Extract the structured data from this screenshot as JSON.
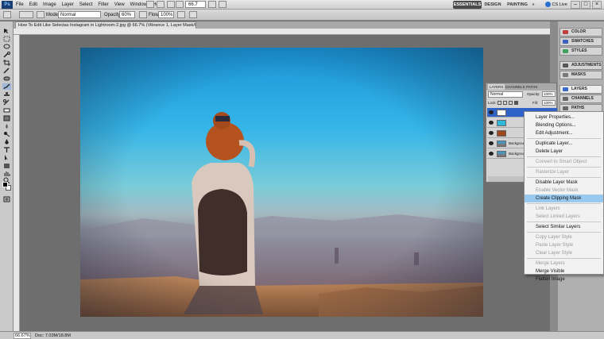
{
  "menubar": {
    "logo": "Ps",
    "items": [
      "File",
      "Edit",
      "Image",
      "Layer",
      "Select",
      "Filter",
      "View",
      "Window",
      "Help"
    ],
    "zoom": "66.7",
    "workspaces": [
      "ESSENTIALS",
      "DESIGN",
      "PAINTING",
      "»"
    ],
    "cs_live": "CS Live"
  },
  "options": {
    "mode_label": "Mode:",
    "mode_value": "Normal",
    "opacity_label": "Opacity:",
    "opacity_value": "60%",
    "flow_label": "Flow:",
    "flow_value": "100%"
  },
  "document": {
    "tab_title": "How To Edit Like Selectas Instagram in Lightroom-2.jpg @ 66.7% (Vibrance 1, Layer Mask/8) *"
  },
  "status": {
    "zoom": "66.67%",
    "doc": "Doc: 7.03M/18.8M"
  },
  "dock": {
    "items": [
      "COLOR",
      "SWATCHES",
      "STYLES",
      "ADJUSTMENTS",
      "MASKS",
      "LAYERS",
      "CHANNELS",
      "PATHS"
    ]
  },
  "layers_panel": {
    "tabs": [
      "LAYERS",
      "CHANNELS",
      "PATHS"
    ],
    "blend": "Normal",
    "opacity_label": "Opacity:",
    "opacity_value": "100%",
    "lock_label": "Lock:",
    "fill_label": "Fill:",
    "fill_value": "100%",
    "layers": [
      "",
      "",
      "",
      "Background",
      "Background"
    ]
  },
  "context_menu": {
    "groups": [
      [
        {
          "label": "Layer Properties...",
          "enabled": true
        },
        {
          "label": "Blending Options...",
          "enabled": true
        },
        {
          "label": "Edit Adjustment...",
          "enabled": true
        }
      ],
      [
        {
          "label": "Duplicate Layer...",
          "enabled": true
        },
        {
          "label": "Delete Layer",
          "enabled": true
        }
      ],
      [
        {
          "label": "Convert to Smart Object",
          "enabled": false
        }
      ],
      [
        {
          "label": "Rasterize Layer",
          "enabled": false
        }
      ],
      [
        {
          "label": "Disable Layer Mask",
          "enabled": true
        },
        {
          "label": "Enable Vector Mask",
          "enabled": false
        },
        {
          "label": "Create Clipping Mask",
          "enabled": true,
          "highlighted": true
        }
      ],
      [
        {
          "label": "Link Layers",
          "enabled": false
        },
        {
          "label": "Select Linked Layers",
          "enabled": false
        }
      ],
      [
        {
          "label": "Select Similar Layers",
          "enabled": true
        }
      ],
      [
        {
          "label": "Copy Layer Style",
          "enabled": false
        },
        {
          "label": "Paste Layer Style",
          "enabled": false
        },
        {
          "label": "Clear Layer Style",
          "enabled": false
        }
      ],
      [
        {
          "label": "Merge Layers",
          "enabled": false
        },
        {
          "label": "Merge Visible",
          "enabled": true
        },
        {
          "label": "Flatten Image",
          "enabled": true
        }
      ]
    ]
  },
  "colors": {
    "menu_highlight": "#99c9ef",
    "selected_layer": "#2f63c8",
    "workspace_active": "#4a4a4a"
  }
}
